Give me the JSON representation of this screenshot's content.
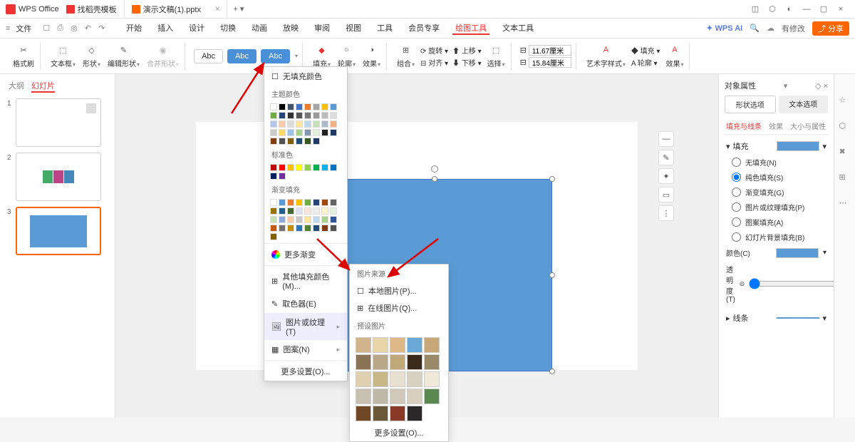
{
  "app": {
    "name": "WPS Office"
  },
  "tabs": [
    {
      "icon": "red",
      "label": "找稻壳模板"
    },
    {
      "icon": "orange",
      "label": "演示文稿(1).pptx"
    }
  ],
  "window_controls": {
    "unsaved": "有修改",
    "share": "分享"
  },
  "menu": {
    "file": "文件",
    "tabs": [
      "开始",
      "插入",
      "设计",
      "切换",
      "动画",
      "放映",
      "审阅",
      "视图",
      "工具",
      "会员专享",
      "绘图工具",
      "文本工具"
    ],
    "active_tab": "绘图工具",
    "wps_ai": "WPS AI"
  },
  "ribbon": {
    "format_painter": "格式刷",
    "textbox": "文本框",
    "shapes": "形状",
    "edit_shape": "编辑形状",
    "merge_shapes": "合并形状",
    "abc": "Abc",
    "fill": "填充",
    "outline": "轮廓",
    "effects": "效果",
    "group": "组合",
    "rotate": "旋转",
    "align": "对齐",
    "bring_fwd": "上移",
    "send_back": "下移",
    "select": "选择",
    "width": "11.67厘米",
    "height": "15.84厘米",
    "wordart": "艺术字样式",
    "text_fill": "填充",
    "text_outline": "轮廓",
    "text_effects": "效果"
  },
  "thumb_tabs": {
    "outline": "大纲",
    "slides": "幻灯片"
  },
  "fill_menu": {
    "no_fill": "无填充颜色",
    "theme_colors": "主题颜色",
    "standard_colors": "标准色",
    "gradient_fill": "渐变填充",
    "more_gradients": "更多渐变",
    "other_colors": "其他填充颜色(M)...",
    "eyedropper": "取色器(E)",
    "picture_texture": "图片或纹理(T)",
    "pattern": "图案(N)",
    "more_settings": "更多设置(O)..."
  },
  "texture_menu": {
    "source": "图片来源",
    "local": "本地图片(P)...",
    "online": "在线图片(Q)...",
    "preset": "预设图片",
    "more": "更多设置(O)..."
  },
  "prop_panel": {
    "title": "对象属性",
    "tab_shape": "形状选项",
    "tab_text": "文本选项",
    "sub_fill": "填充与线条",
    "sub_effects": "效果",
    "sub_size": "大小与属性",
    "fill_hdr": "填充",
    "no_fill": "无填充(N)",
    "solid": "纯色填充(S)",
    "gradient": "渐变填充(G)",
    "pic_texture": "图片或纹理填充(P)",
    "pattern": "图案填充(A)",
    "slide_bg": "幻灯片背景填充(B)",
    "color_lbl": "颜色(C)",
    "opacity_lbl": "透明度(T)",
    "opacity_val": "0",
    "opacity_unit": "%",
    "line_hdr": "线条"
  },
  "colors": {
    "theme": [
      "#ffffff",
      "#000000",
      "#44546a",
      "#4472c4",
      "#ed7d31",
      "#a5a5a5",
      "#ffc000",
      "#5b9bd5",
      "#70ad47",
      "#264478",
      "#333333",
      "#555555",
      "#777777",
      "#999999",
      "#bbbbbb",
      "#dddddd",
      "#b4c6e7",
      "#f8cbad",
      "#dbdbdb",
      "#ffe699",
      "#bdd7ee",
      "#c5e0b4",
      "#adb9ca",
      "#f4b183",
      "#c9c9c9",
      "#ffd966",
      "#9cc3e6",
      "#a9d18e",
      "#8497b0",
      "#e2f0d9",
      "#222222",
      "#1f3864",
      "#833c0c",
      "#525252",
      "#806000",
      "#1f4e79",
      "#385723",
      "#203864"
    ],
    "standard": [
      "#c00000",
      "#ff0000",
      "#ffc000",
      "#ffff00",
      "#92d050",
      "#00b050",
      "#00b0f0",
      "#0070c0",
      "#002060",
      "#7030a0"
    ],
    "gradients": [
      "#ffffff",
      "#5b9bd5",
      "#ed7d31",
      "#ffc000",
      "#70ad47",
      "#264478",
      "#9e480e",
      "#636363",
      "#997300",
      "#255e91",
      "#43682b",
      "#d9e1f2",
      "#fce4d6",
      "#ededed",
      "#fff2cc",
      "#e2efda",
      "#c6e0b4",
      "#8ea9db",
      "#f8cbad",
      "#c9c9c9",
      "#ffe699",
      "#bdd7ee",
      "#a9d18e",
      "#305496",
      "#c65911",
      "#757171",
      "#bf8f00",
      "#2f75b5",
      "#548235",
      "#1f4e78",
      "#833c0c",
      "#525252",
      "#806000"
    ],
    "textures": [
      "#d2b48c",
      "#e8d5a8",
      "#deb887",
      "#6aa8d8",
      "#c8a878",
      "#8b7355",
      "#b8a888",
      "#c0a878",
      "#3a2a1a",
      "#9a8a6a",
      "#e0d0b0",
      "#c8b888",
      "#e8e0d0",
      "#d8d0c0",
      "#f0e8d8",
      "#c8c0b0",
      "#c0b8a8",
      "#d0c8b8",
      "#d8cfbf",
      "#5a8850",
      "#704828",
      "#6a5838",
      "#8a3828",
      "#2a2828"
    ]
  }
}
